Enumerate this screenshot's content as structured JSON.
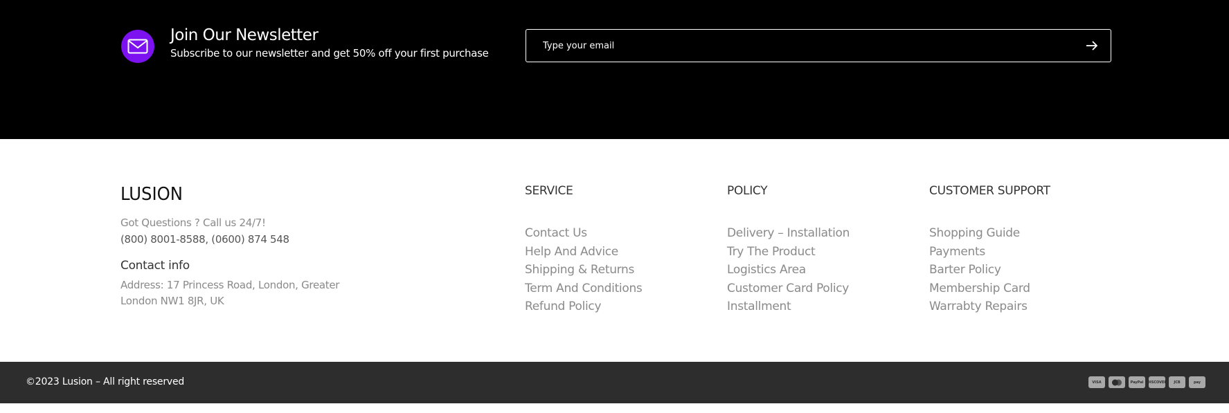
{
  "newsletter": {
    "title": "Join Our Newsletter",
    "subtitle": "Subscribe to our newsletter and get 50% off your first purchase",
    "email_placeholder": "Type your email",
    "icon": "mail-icon",
    "submit_icon": "arrow-right-icon",
    "icon_bg_color": "#7b12ef",
    "bg_color": "#000000"
  },
  "brand": {
    "logo": "LUSION",
    "questions": "Got Questions ? Call us 24/7!",
    "phones": "(800) 8001-8588, (0600) 874 548",
    "contact_heading": "Contact info",
    "address": "Address: 17 Princess Road, London, Greater London NW1 8JR, UK"
  },
  "columns": [
    {
      "heading": "SERVICE",
      "links": [
        "Contact Us",
        "Help And Advice",
        "Shipping & Returns",
        "Term And Conditions",
        "Refund Policy"
      ]
    },
    {
      "heading": "POLICY",
      "links": [
        "Delivery – Installation",
        "Try The Product",
        "Logistics Area",
        "Customer Card Policy",
        "Installment"
      ]
    },
    {
      "heading": "CUSTOMER SUPPORT",
      "links": [
        "Shopping Guide",
        "Payments",
        "Barter Policy",
        "Membership Card",
        "Warrabty Repairs"
      ]
    }
  ],
  "bottom": {
    "copyright": "©2023 Lusion – All right reserved",
    "bg_color": "#2d2d2d",
    "payment_icons": [
      {
        "name": "visa-icon",
        "label": "VISA"
      },
      {
        "name": "mastercard-icon",
        "label": ""
      },
      {
        "name": "paypal-icon",
        "label": "PayPal"
      },
      {
        "name": "discover-icon",
        "label": "DISCOVER"
      },
      {
        "name": "jcb-icon",
        "label": "JCB"
      },
      {
        "name": "amazon-pay-icon",
        "label": "pay"
      }
    ]
  }
}
